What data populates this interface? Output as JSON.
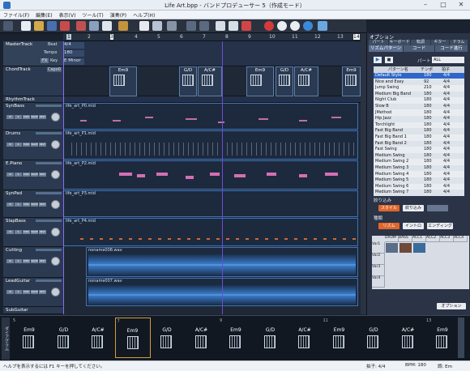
{
  "window": {
    "title": "Life Art.bpp - バンドプロデューサー 5（作成モード）"
  },
  "menu": [
    "ファイル(F)",
    "編集(E)",
    "表示(V)",
    "ツール(T)",
    "演奏(P)",
    "ヘルプ(H)"
  ],
  "ruler": [
    "1",
    "2",
    "3",
    "4",
    "5",
    "6",
    "7",
    "8",
    "9",
    "10",
    "11",
    "12",
    "13",
    "14"
  ],
  "master": {
    "name": "MasterTrack",
    "beat_label": "Beat",
    "beat": "4/4",
    "tempo_label": "Tempo",
    "tempo": "180",
    "key_label": "Key",
    "key": "E Minor",
    "fx": "FX"
  },
  "chordtrack": {
    "name": "ChordTrack",
    "capo": "Capo0"
  },
  "tracks": [
    {
      "name": "RhythmTrack"
    },
    {
      "name": "SynBass",
      "clip": "life_art_P0.mid"
    },
    {
      "name": "Drums",
      "clip": "life_art_P1.mid"
    },
    {
      "name": "E.Piano",
      "clip": "life_art_P2.mid"
    },
    {
      "name": "SynPad",
      "clip": "life_art_P3.mid"
    },
    {
      "name": "SlapBass",
      "clip": "life_art_P4.mid"
    },
    {
      "name": "Cutting",
      "clip": "noname008.wav"
    },
    {
      "name": "LeadGuitar",
      "clip": "noname007.wav"
    },
    {
      "name": "SubGuitar"
    }
  ],
  "track_buttons": [
    "M",
    "S",
    "MIDI",
    "WAVE",
    "INST"
  ],
  "chord_boxes": [
    "Em9",
    "G/D",
    "A/C#",
    "Em9",
    "G/D",
    "A/C#",
    "Em9"
  ],
  "panel": {
    "title": "オプション",
    "tabs": [
      "パート",
      "キーボード",
      "転調",
      "ギター",
      "ドラム"
    ],
    "subtabs": [
      "リズムパターン",
      "コード",
      "コード進行"
    ],
    "part_label": "パート",
    "part_value": "ALL",
    "columns": [
      "パターン名",
      "テンポ",
      "拍子"
    ],
    "patterns": [
      [
        "Default Style",
        "180",
        "4/4"
      ],
      [
        "Nice and Easy",
        "92",
        "4/4"
      ],
      [
        "Jump Swing",
        "210",
        "4/4"
      ],
      [
        "Medium Big Band",
        "180",
        "4/4"
      ],
      [
        "Night Club",
        "180",
        "4/4"
      ],
      [
        "Slow B",
        "180",
        "4/4"
      ],
      [
        "JMethod",
        "180",
        "4/4"
      ],
      [
        "Hip Jazz",
        "180",
        "4/4"
      ],
      [
        "Torchlight",
        "180",
        "4/4"
      ],
      [
        "Fast Big Band",
        "180",
        "4/4"
      ],
      [
        "Fast Big Band 1",
        "180",
        "4/4"
      ],
      [
        "Fast Big Band 2",
        "180",
        "4/4"
      ],
      [
        "Fast Swing",
        "180",
        "4/4"
      ],
      [
        "Medium Swing",
        "180",
        "4/4"
      ],
      [
        "Medium Swing 2",
        "180",
        "4/4"
      ],
      [
        "Medium Swing 3",
        "180",
        "4/4"
      ],
      [
        "Medium Swing 4",
        "180",
        "4/4"
      ],
      [
        "Medium Swing 5",
        "180",
        "4/4"
      ],
      [
        "Medium Swing 6",
        "180",
        "4/4"
      ],
      [
        "Medium Swing 7",
        "180",
        "4/4"
      ]
    ],
    "filter_label": "絞り込み",
    "filter_buttons": [
      "スタイル",
      "絞り込み",
      ""
    ],
    "variation_label": "種類",
    "variation_buttons": [
      "リズム",
      "イントロ",
      "エンディング"
    ],
    "grid_cols": [
      "DRUM",
      "BASS",
      "ACC1",
      "ACC2",
      "ACC3",
      "ACC4"
    ],
    "grid_rows": [
      "Var1",
      "Var2",
      "Var3",
      "Var4"
    ],
    "option_button": "オプション"
  },
  "strip": {
    "chords": [
      "Em9",
      "G/D",
      "A/C#",
      "Em9",
      "G/D",
      "A/C#",
      "Em9",
      "G/D",
      "A/C#",
      "Em9",
      "G/D",
      "A/C#",
      "Em9"
    ],
    "bars": [
      "5",
      "",
      "",
      "7",
      "",
      "",
      "9",
      "",
      "",
      "11",
      "",
      "",
      "13"
    ],
    "side_label": "ダイアグラム"
  },
  "status": {
    "help": "ヘルプを表示するには F1 キーを押してください。",
    "beat": "拍子: 4/4",
    "bpm": "BPM: 180",
    "key": "調: Em"
  },
  "colors": {
    "accent": "#3a8ad8",
    "note": "#d46fb5",
    "clip_border": "#3e73b8",
    "wave": "#5aa2ee"
  }
}
